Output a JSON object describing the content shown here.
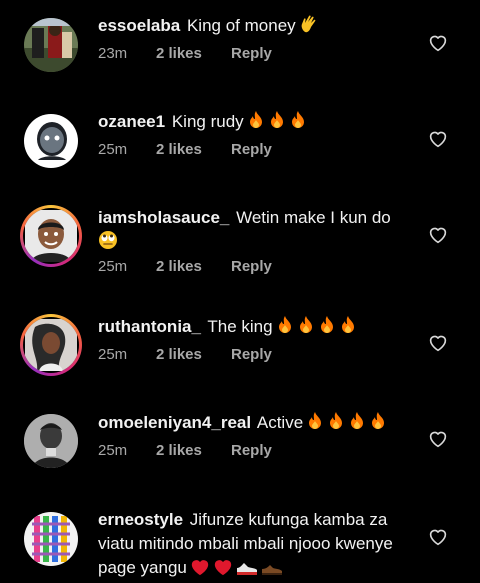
{
  "comments": [
    {
      "username": "essoelaba",
      "text": "King of money",
      "emoji": [
        "wave"
      ],
      "time": "23m",
      "likes": "2 likes",
      "reply": "Reply"
    },
    {
      "username": "ozanee1",
      "text": "King rudy",
      "emoji": [
        "fire",
        "fire",
        "fire"
      ],
      "time": "25m",
      "likes": "2 likes",
      "reply": "Reply"
    },
    {
      "username": "iamsholasauce_",
      "text": "Wetin make I kun do",
      "emoji": [
        "eye-roll"
      ],
      "time": "25m",
      "likes": "2 likes",
      "reply": "Reply"
    },
    {
      "username": "ruthantonia_",
      "text": "The king",
      "emoji": [
        "fire",
        "fire",
        "fire",
        "fire"
      ],
      "time": "25m",
      "likes": "2 likes",
      "reply": "Reply"
    },
    {
      "username": "omoeleniyan4_real",
      "text": "Active",
      "emoji": [
        "fire",
        "fire",
        "fire",
        "fire"
      ],
      "time": "25m",
      "likes": "2 likes",
      "reply": "Reply"
    },
    {
      "username": "erneostyle",
      "text": "Jifunze kufunga kamba za viatu mitindo mbali mbali njooo kwenye page yangu",
      "emoji": [
        "red-heart",
        "red-heart",
        "sneaker",
        "shoe"
      ]
    }
  ],
  "colors": {
    "background": "#000000",
    "text": "#f2f2f2",
    "meta": "#a8a8a8",
    "fire": "#ff7a00"
  }
}
